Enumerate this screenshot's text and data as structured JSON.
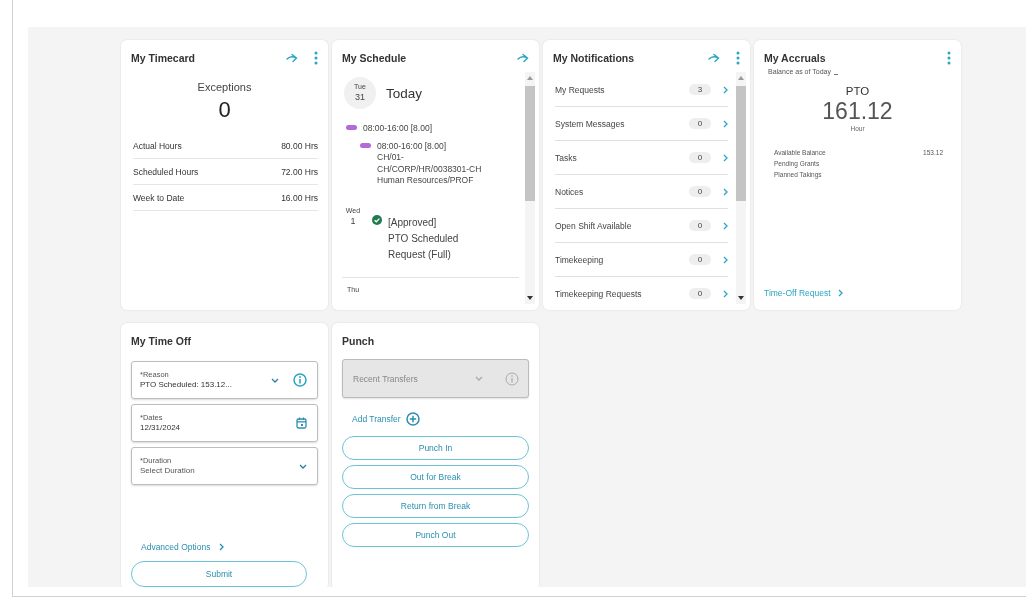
{
  "timecard": {
    "title": "My Timecard",
    "exceptions_label": "Exceptions",
    "exceptions_value": "0",
    "rows": [
      {
        "label": "Actual Hours",
        "value": "80.00 Hrs"
      },
      {
        "label": "Scheduled Hours",
        "value": "72.00 Hrs"
      },
      {
        "label": "Week to Date",
        "value": "16.00 Hrs"
      }
    ]
  },
  "schedule": {
    "title": "My Schedule",
    "days": [
      {
        "weekday": "Tue",
        "date": "31",
        "heading": "Today",
        "entries": [
          {
            "kind": "shift",
            "text": "08:00-16:00 [8.00]"
          },
          {
            "kind": "segment",
            "text": "08:00-16:00 [8.00]",
            "detail": "CH/01-CH/CORP/HR/0038301-CH Human Resources/PROF"
          }
        ]
      },
      {
        "weekday": "Wed",
        "date": "1",
        "entries": [
          {
            "kind": "approved",
            "text": "[Approved]",
            "detail": "PTO Scheduled Request (Full)"
          }
        ]
      },
      {
        "weekday": "Thu"
      }
    ]
  },
  "notifications": {
    "title": "My Notifications",
    "items": [
      {
        "label": "My Requests",
        "count": "3"
      },
      {
        "label": "System Messages",
        "count": "0"
      },
      {
        "label": "Tasks",
        "count": "0"
      },
      {
        "label": "Notices",
        "count": "0"
      },
      {
        "label": "Open Shift Available",
        "count": "0"
      },
      {
        "label": "Timekeeping",
        "count": "0"
      },
      {
        "label": "Timekeeping Requests",
        "count": "0"
      }
    ]
  },
  "accruals": {
    "title": "My Accruals",
    "subtitle": "Balance as of Today",
    "type": "PTO",
    "amount": "161.12",
    "unit": "Hour",
    "details": [
      {
        "label": "Available Balance",
        "value": "153.12"
      },
      {
        "label": "Pending Grants"
      },
      {
        "label": "Planned Takings"
      }
    ],
    "link": "Time-Off Request"
  },
  "time_off": {
    "title": "My Time Off",
    "fields": [
      {
        "kind": "select",
        "label": "*Reason",
        "value": "PTO Scheduled: 153.12...",
        "info": true
      },
      {
        "kind": "date",
        "label": "*Dates",
        "value": "12/31/2024"
      },
      {
        "kind": "select",
        "label": "*Duration",
        "placeholder": "Select Duration"
      }
    ],
    "advanced_link": "Advanced Options",
    "submit": "Submit"
  },
  "punch": {
    "title": "Punch",
    "transfer": {
      "placeholder": "Recent Transfers",
      "disabled": true
    },
    "add_transfer": "Add Transfer",
    "buttons": [
      "Punch In",
      "Out for Break",
      "Return from Break",
      "Punch Out"
    ]
  }
}
